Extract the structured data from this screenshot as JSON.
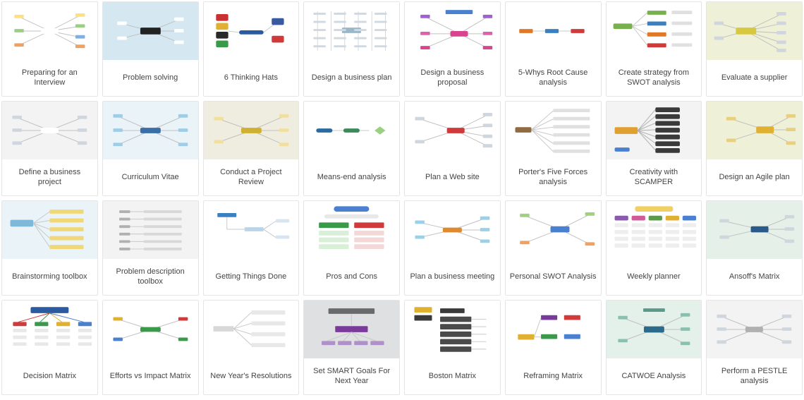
{
  "templates": [
    {
      "label": "Preparing for an Interview",
      "bg": "bg-white",
      "accent": "#f0b000",
      "style": "spread"
    },
    {
      "label": "Problem solving",
      "bg": "bg-blue",
      "accent": "#222222",
      "style": "center"
    },
    {
      "label": "6 Thinking Hats",
      "bg": "bg-white",
      "accent": "#c83232",
      "style": "hats"
    },
    {
      "label": "Design a business plan",
      "bg": "bg-white",
      "accent": "#9ab6c8",
      "style": "grid"
    },
    {
      "label": "Design a business proposal",
      "bg": "bg-white",
      "accent": "#d9448f",
      "style": "proposal"
    },
    {
      "label": "5-Whys Root Cause analysis",
      "bg": "bg-white",
      "accent": "#e07828",
      "style": "bar"
    },
    {
      "label": "Create strategy from SWOT analysis",
      "bg": "bg-white",
      "accent": "#78b050",
      "style": "swot"
    },
    {
      "label": "Evaluate a supplier",
      "bg": "bg-olive",
      "accent": "#d8c840",
      "style": "supplier"
    },
    {
      "label": "Define a business project",
      "bg": "bg-gray",
      "accent": "#7a8aa0",
      "style": "project"
    },
    {
      "label": "Curriculum Vitae",
      "bg": "bg-lblue",
      "accent": "#3a6ea8",
      "style": "cv"
    },
    {
      "label": "Conduct a Project Review",
      "bg": "bg-tan",
      "accent": "#d0b030",
      "style": "review"
    },
    {
      "label": "Means-end analysis",
      "bg": "bg-white",
      "accent": "#3a8a5a",
      "style": "means"
    },
    {
      "label": "Plan a Web site",
      "bg": "bg-white",
      "accent": "#d03a3a",
      "style": "website"
    },
    {
      "label": "Porter's Five Forces analysis",
      "bg": "bg-white",
      "accent": "#906a40",
      "style": "porter"
    },
    {
      "label": "Creativity with SCAMPER",
      "bg": "bg-gray",
      "accent": "#e0a030",
      "style": "scamper"
    },
    {
      "label": "Design an Agile plan",
      "bg": "bg-olive",
      "accent": "#e0b030",
      "style": "agile"
    },
    {
      "label": "Brainstorming toolbox",
      "bg": "bg-lblue",
      "accent": "#e0b030",
      "style": "brain"
    },
    {
      "label": "Problem description toolbox",
      "bg": "bg-gray",
      "accent": "#888888",
      "style": "probdesc"
    },
    {
      "label": "Getting Things Done",
      "bg": "bg-white",
      "accent": "#3a80c0",
      "style": "gtd"
    },
    {
      "label": "Pros and Cons",
      "bg": "bg-white",
      "accent": "#3a9a4a",
      "style": "pros"
    },
    {
      "label": "Plan a business meeting",
      "bg": "bg-white",
      "accent": "#e08a30",
      "style": "meeting"
    },
    {
      "label": "Personal SWOT Analysis",
      "bg": "bg-white",
      "accent": "#4a80d0",
      "style": "pswot"
    },
    {
      "label": "Weekly planner",
      "bg": "bg-white",
      "accent": "#e0b030",
      "style": "planner"
    },
    {
      "label": "Ansoff's Matrix",
      "bg": "bg-sea",
      "accent": "#2a5a8a",
      "style": "ansoff"
    },
    {
      "label": "Decision Matrix",
      "bg": "bg-white",
      "accent": "#2a5aa0",
      "style": "decision"
    },
    {
      "label": "Efforts vs Impact Matrix",
      "bg": "bg-white",
      "accent": "#3a9a4a",
      "style": "efforts"
    },
    {
      "label": "New Year's Resolutions",
      "bg": "bg-white",
      "accent": "#888888",
      "style": "resolutions"
    },
    {
      "label": "Set SMART Goals For Next Year",
      "bg": "bg-dkgray",
      "accent": "#7a3a9a",
      "style": "smart"
    },
    {
      "label": "Boston Matrix",
      "bg": "bg-white",
      "accent": "#3a3a3a",
      "style": "boston"
    },
    {
      "label": "Reframing Matrix",
      "bg": "bg-white",
      "accent": "#e0b030",
      "style": "reframe"
    },
    {
      "label": "CATWOE Analysis",
      "bg": "bg-mint",
      "accent": "#2a6a8a",
      "style": "catwoe"
    },
    {
      "label": "Perform a PESTLE analysis",
      "bg": "bg-gray",
      "accent": "#888888",
      "style": "pestle"
    }
  ]
}
